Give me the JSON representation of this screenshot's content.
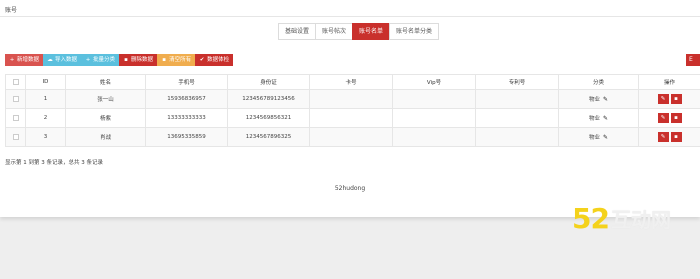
{
  "page": {
    "title": "账号"
  },
  "tabs": [
    {
      "label": "基础设置",
      "active": false
    },
    {
      "label": "账号帖次",
      "active": false
    },
    {
      "label": "账号名单",
      "active": true
    },
    {
      "label": "账号名单分类",
      "active": false
    }
  ],
  "toolbar": {
    "add_label": "新增数据",
    "import_label": "导入数据",
    "category_label": "批量分类",
    "delete_label": "删除数据",
    "clear_label": "清空所有",
    "inspect_label": "数据体检",
    "right_label": "E"
  },
  "table": {
    "columns": [
      "ID",
      "姓名",
      "手机号",
      "身份证",
      "卡号",
      "Vip号",
      "专利号",
      "分类",
      "操作"
    ],
    "rows": [
      {
        "id": "1",
        "name": "张一山",
        "phone": "15936836957",
        "idcard": "123456789123456",
        "card": "",
        "vip": "",
        "patent": "",
        "category": "物业"
      },
      {
        "id": "2",
        "name": "杨紫",
        "phone": "13333333333",
        "idcard": "1234569856321",
        "card": "",
        "vip": "",
        "patent": "",
        "category": "物业"
      },
      {
        "id": "3",
        "name": "肖战",
        "phone": "13695335859",
        "idcard": "1234567896325",
        "card": "",
        "vip": "",
        "patent": "",
        "category": "物业"
      }
    ]
  },
  "pagination": {
    "summary": "显示第 1 到第 3 条记录，总共 3 条记录"
  },
  "center_note": "52hudong",
  "watermark": {
    "number": "52",
    "text": "互动网"
  },
  "colors": {
    "danger": "#d9534f",
    "danger_dark": "#c9302c",
    "info": "#5bc0de",
    "warning": "#f0ad4e",
    "watermark": "#f4d21c"
  }
}
